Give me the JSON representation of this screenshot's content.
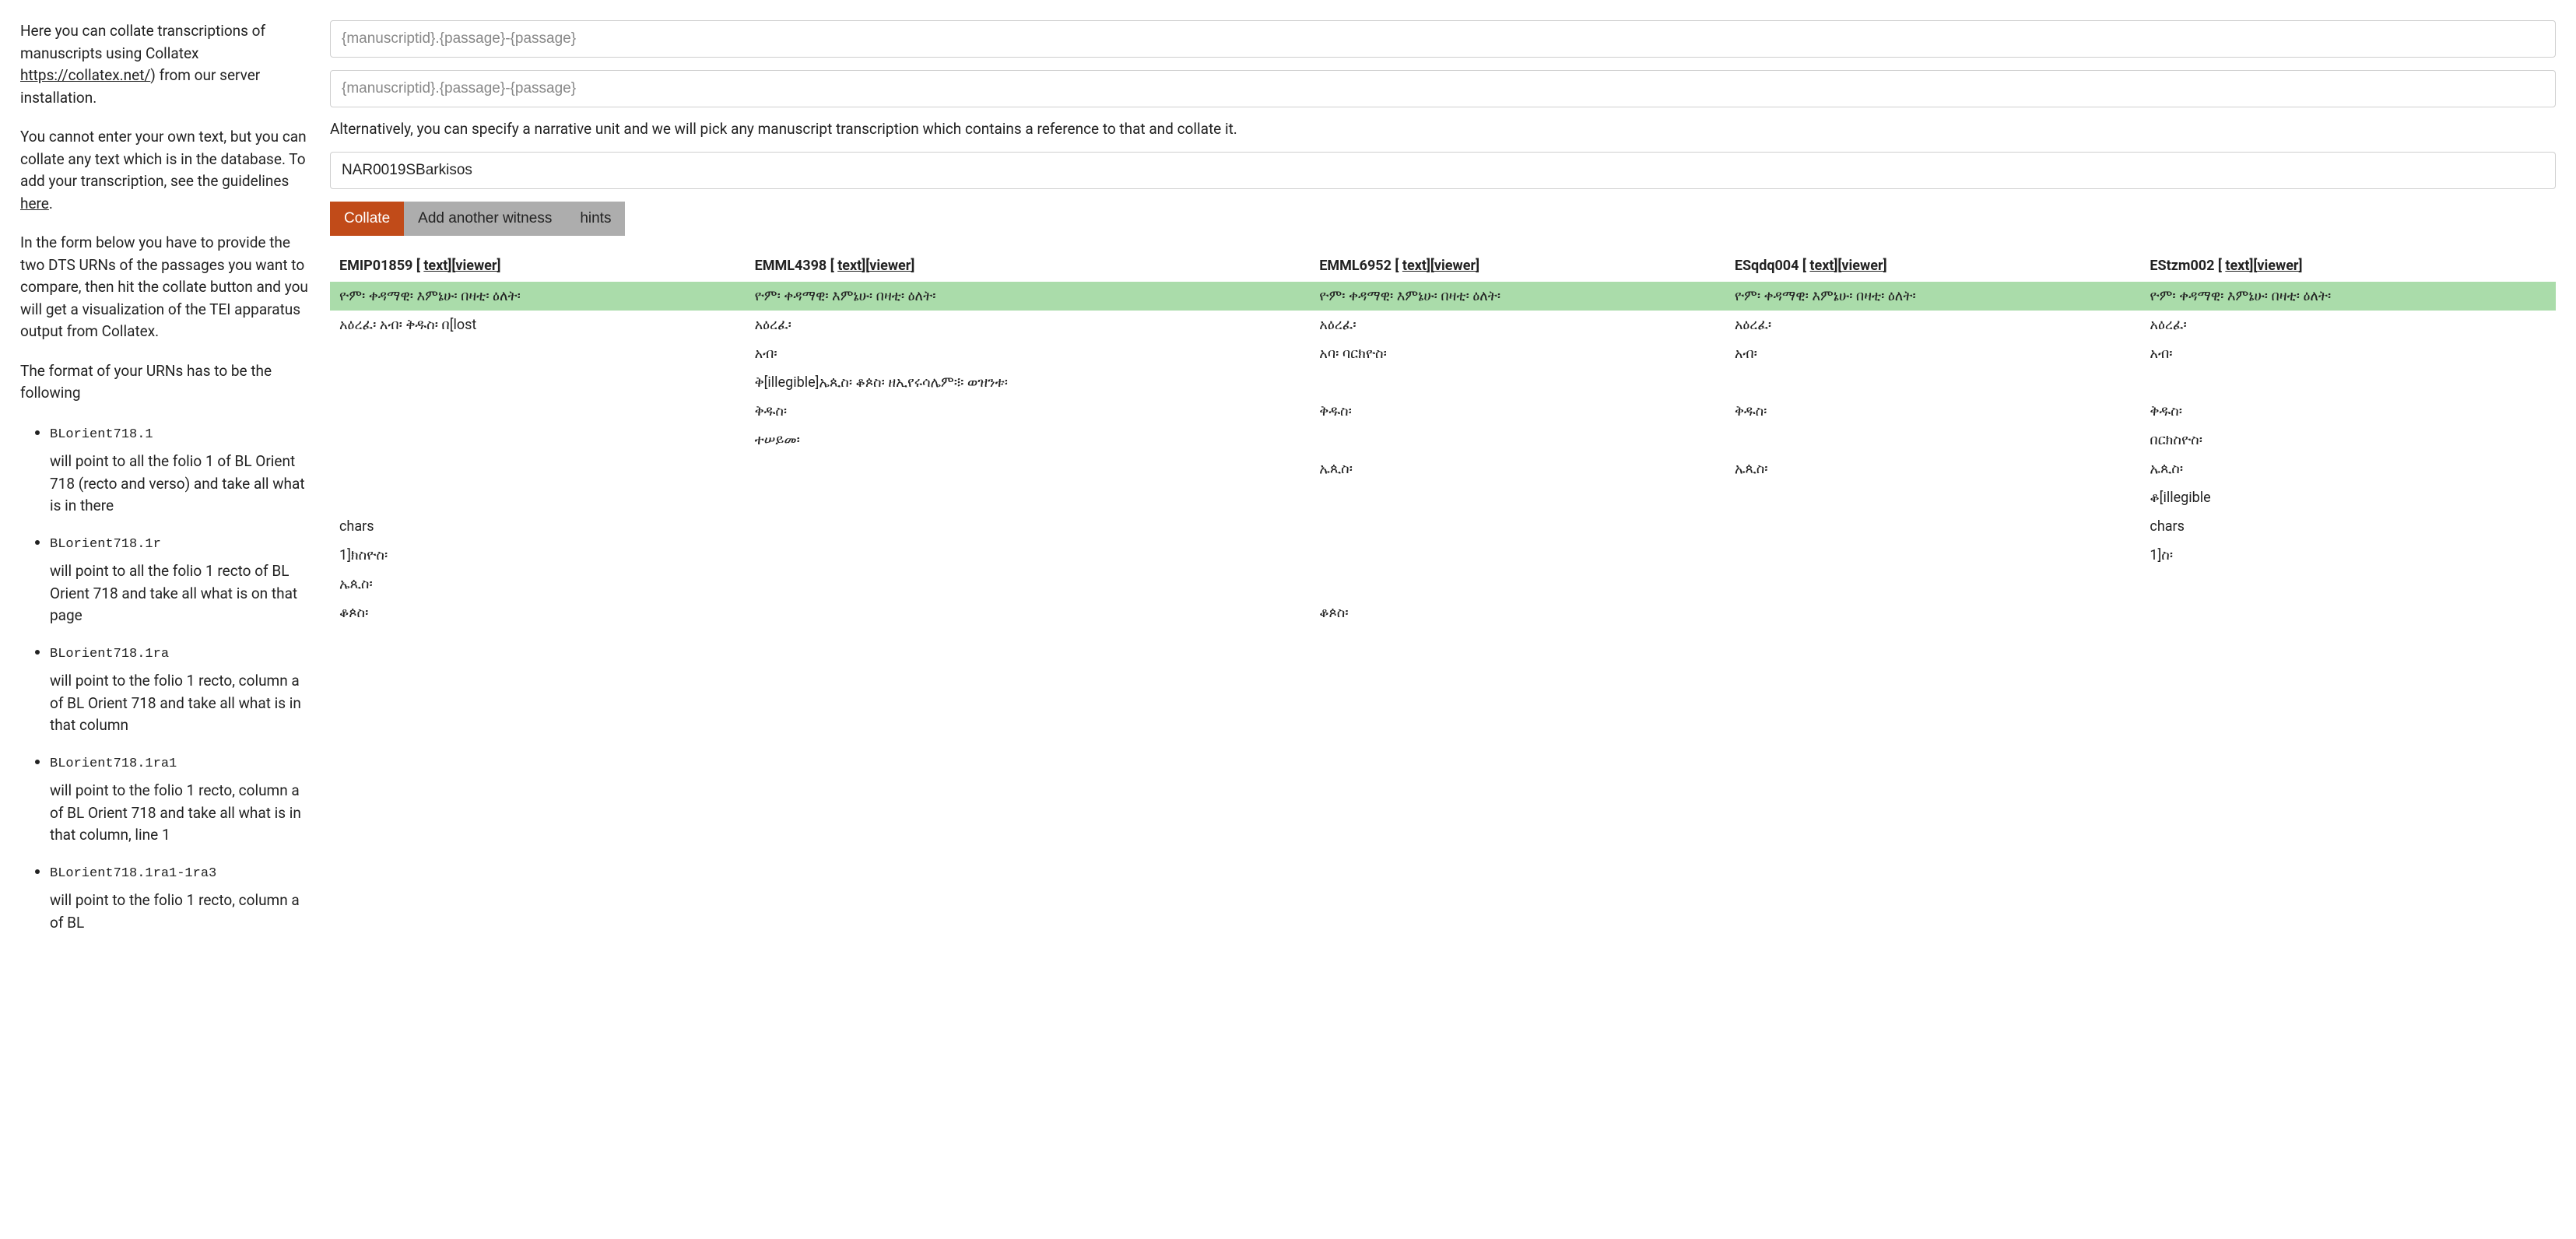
{
  "intro": {
    "p1_pre": "Here you can collate transcriptions of manuscripts using Collatex ",
    "p1_link": "https://collatex.net/",
    "p1_post": ") from our server installation.",
    "p2_pre": "You cannot enter your own text, but you can collate any text which is in the database. To add your transcription, see the guidelines ",
    "p2_link": "here",
    "p2_post": ".",
    "p3": "In the form below you have to provide the two DTS URNs of the passages you want to compare, then hit the collate button and you will get a visualization of the TEI apparatus output from Collatex.",
    "p4": "The format of your URNs has to be the following"
  },
  "examples": [
    {
      "code": "BLorient718.1",
      "desc": "will point to all the folio 1 of BL Orient 718 (recto and verso) and take all what is in there"
    },
    {
      "code": "BLorient718.1r",
      "desc": "will point to all the folio 1 recto of BL Orient 718 and take all what is on that page"
    },
    {
      "code": "BLorient718.1ra",
      "desc": "will point to the folio 1 recto, column a of BL Orient 718 and take all what is in that column"
    },
    {
      "code": "BLorient718.1ra1",
      "desc": "will point to the folio 1 recto, column a of BL Orient 718 and take all what is in that column, line 1"
    },
    {
      "code": "BLorient718.1ra1-1ra3",
      "desc": "will point to the folio 1 recto, column a of BL"
    }
  ],
  "form": {
    "placeholder": "{manuscriptid}.{passage}-{passage}",
    "alt_text": "Alternatively, you can specify a narrative unit and we will pick any manuscript transcription which contains a reference to that and collate it.",
    "narrative_value": "NAR0019SBarkisos",
    "btn_collate": "Collate",
    "btn_add": "Add another witness",
    "btn_hints": "hints"
  },
  "table": {
    "link_text": "text",
    "link_viewer": "viewer",
    "headers": [
      "EMIP01859",
      "EMML4398",
      "EMML6952",
      "ESqdq004",
      "EStzm002"
    ],
    "rows": [
      {
        "match": true,
        "cells": [
          "ዮም፡ ቀዳማዊ፡ እምኔሁ፡ በዛቲ፡ ዕለት፡",
          "ዮም፡ ቀዳማዊ፡ እምኔሁ፡ በዛቲ፡ ዕለት፡",
          "ዮም፡ ቀዳማዊ፡ እምኔሁ፡ በዛቲ፡ ዕለት፡",
          "ዮም፡ ቀዳማዊ፡ እምኔሁ፡ በዛቲ፡ ዕለት፡",
          "ዮም፡ ቀዳማዊ፡ እምኔሁ፡ በዛቲ፡ ዕለት፡"
        ]
      },
      {
        "match": false,
        "cells": [
          "አዕረፈ፡ አብ፡ ቅዱስ፡ በ[lost",
          "አዕረፈ፡",
          "አዕረፈ፡",
          "አዕረፈ፡",
          "አዕረፈ፡"
        ]
      },
      {
        "match": false,
        "cells": [
          "",
          "አብ፡",
          "አባ፡ ባርክዮስ፡",
          "አብ፡",
          "አብ፡"
        ]
      },
      {
        "match": false,
        "cells": [
          "",
          "ቅ[illegible]ኤጲስ፡ ቆጶስ፡ ዘኢየሩሳሌም፨ ወዝንቱ፡",
          "",
          "",
          ""
        ]
      },
      {
        "match": false,
        "cells": [
          "",
          "ቅዱስ፡",
          "ቅዱስ፡",
          "ቅዱስ፡",
          "ቅዱስ፡"
        ]
      },
      {
        "match": false,
        "cells": [
          "",
          "ተሠይመ፡",
          "",
          "",
          "በርክስዮስ፡"
        ]
      },
      {
        "match": false,
        "cells": [
          "",
          "",
          "ኤጲስ፡",
          "ኤጲስ፡",
          "ኤጲስ፡"
        ]
      },
      {
        "match": false,
        "cells": [
          "",
          "",
          "",
          "",
          "ቆ[illegible"
        ]
      },
      {
        "match": false,
        "cells": [
          "chars",
          "",
          "",
          "",
          "chars"
        ]
      },
      {
        "match": false,
        "cells": [
          "1]ክስዮስ፡",
          "",
          "",
          "",
          "1]ስ፡"
        ]
      },
      {
        "match": false,
        "cells": [
          "ኤጲስ፡",
          "",
          "",
          "",
          ""
        ]
      },
      {
        "match": false,
        "cells": [
          "ቆጶስ፡",
          "",
          "ቆጶስ፡",
          "",
          ""
        ]
      }
    ]
  }
}
